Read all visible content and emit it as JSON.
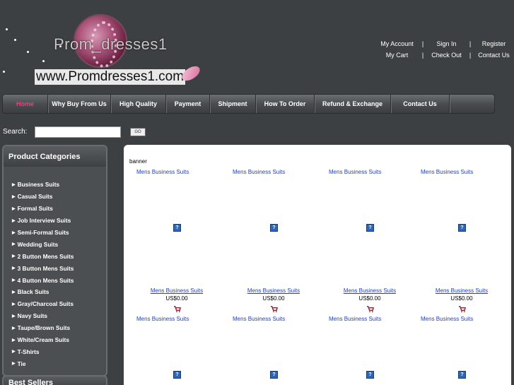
{
  "logo": {
    "name": "Prom_dresses1",
    "url": "www.Promdresses1.com"
  },
  "toplinks": {
    "row1": [
      "My Account",
      "Sign In",
      "Register"
    ],
    "row2": [
      "My Cart",
      "Check Out",
      "Contact Us"
    ],
    "separator": "|"
  },
  "nav": {
    "items": [
      {
        "label": "Home",
        "active": true
      },
      {
        "label": "Why Buy From Us",
        "active": false
      },
      {
        "label": "High Quality",
        "active": false
      },
      {
        "label": "Payment",
        "active": false
      },
      {
        "label": "Shipment",
        "active": false
      },
      {
        "label": "How To Order",
        "active": false
      },
      {
        "label": "Refund & Exchange",
        "active": false
      },
      {
        "label": "Contact Us",
        "active": false
      }
    ]
  },
  "search": {
    "label": "Search:",
    "value": "",
    "button": "GO"
  },
  "sidebar": {
    "title": "Product Categories",
    "categories": [
      "Business Suits",
      "Casual Suits",
      "Formal Suits",
      "Job Interview Suits",
      "Semi-Formal Suits",
      "Wedding Suits",
      "2 Button Mens Suits",
      "3 Button Mens Suits",
      "4 Button Mens Suits",
      "Black Suits",
      "Gray/Charcoal Suits",
      "Navy Suits",
      "Taupe/Brown Suits",
      "White/Cream Suits",
      "T-Shirts",
      "Tie"
    ],
    "second_title": "Best Sellers"
  },
  "main": {
    "banner": "banner",
    "row1": [
      {
        "title": "Mens Business Suits",
        "link": "Mens Business Suits",
        "price": "US$0.00"
      },
      {
        "title": "Mens Business Suits",
        "link": "Mens Business Suits",
        "price": "US$0.00"
      },
      {
        "title": "Mens Business Suits",
        "link": "Mens Business Suits",
        "price": "US$0.00"
      },
      {
        "title": "Mens Business Suits",
        "link": "Mens Business Suits",
        "price": "US$0.00"
      }
    ],
    "row2": [
      {
        "title": "Mens Business Suits"
      },
      {
        "title": "Mens Business Suits"
      },
      {
        "title": "Mens Business Suits"
      },
      {
        "title": "Mens Business Suits"
      }
    ],
    "image_placeholder": "?"
  },
  "colors": {
    "background": "#3d4042",
    "nav_active": "#e8427a",
    "link": "#1b3fd8"
  },
  "icons": {
    "placeholder": "broken-image-icon",
    "cart": "add-to-cart-icon"
  }
}
